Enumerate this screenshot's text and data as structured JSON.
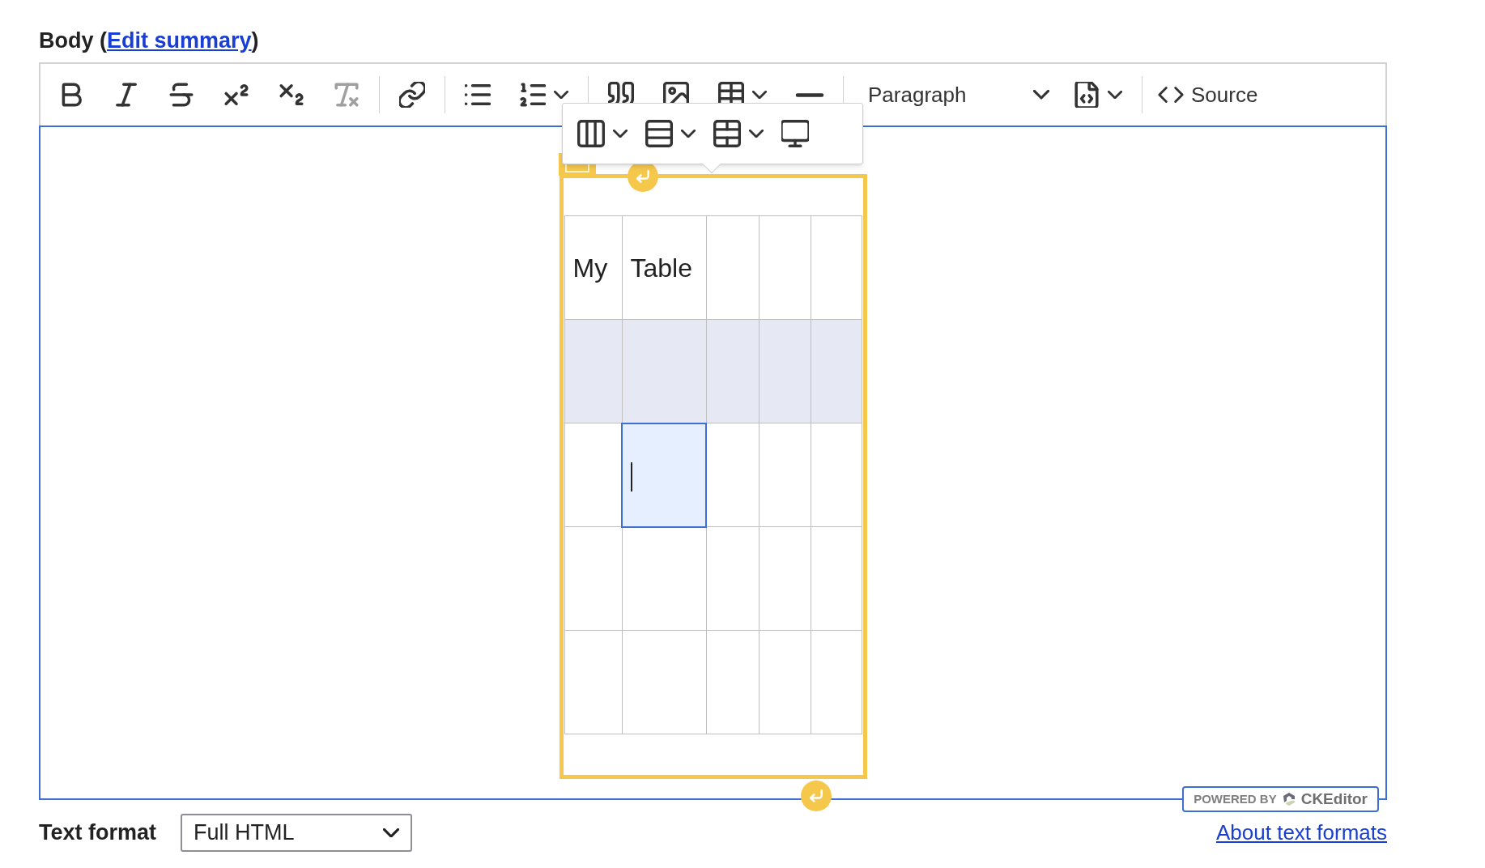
{
  "field_label": {
    "text": "Body (",
    "link": "Edit summary",
    "after": ")"
  },
  "toolbar": [
    {
      "kind": "bold",
      "disabled": false
    },
    {
      "kind": "italic",
      "disabled": false
    },
    {
      "kind": "strikethrough",
      "disabled": false
    },
    {
      "kind": "superscript",
      "disabled": false
    },
    {
      "kind": "subscript",
      "disabled": false
    },
    {
      "kind": "removeformat",
      "disabled": true
    },
    {
      "kind": "separator"
    },
    {
      "kind": "link",
      "disabled": false
    },
    {
      "kind": "separator"
    },
    {
      "kind": "bulletlist",
      "disabled": false
    },
    {
      "kind": "numberlist",
      "disabled": false,
      "dropdown": true
    },
    {
      "kind": "separator"
    },
    {
      "kind": "blockquote",
      "disabled": false
    },
    {
      "kind": "image",
      "disabled": false
    },
    {
      "kind": "table",
      "disabled": false,
      "dropdown": true
    },
    {
      "kind": "hline",
      "disabled": false
    },
    {
      "kind": "separator"
    },
    {
      "kind": "heading",
      "label": "Paragraph"
    },
    {
      "kind": "codeblock",
      "disabled": false,
      "dropdown": true
    },
    {
      "kind": "separator"
    },
    {
      "kind": "source",
      "label": "Source"
    }
  ],
  "table_toolbar": [
    {
      "kind": "column",
      "dropdown": true
    },
    {
      "kind": "row",
      "dropdown": true
    },
    {
      "kind": "merge",
      "dropdown": true
    },
    {
      "kind": "properties",
      "dropdown": false
    }
  ],
  "table": {
    "rows": [
      {
        "highlighted": false,
        "cells": [
          {
            "text": "My",
            "selected": false
          },
          {
            "text": "Table",
            "selected": false
          },
          {
            "selected": false
          },
          {
            "selected": false
          },
          {
            "selected": false
          }
        ]
      },
      {
        "highlighted": true,
        "cells": [
          {
            "selected": false
          },
          {
            "selected": false
          },
          {
            "selected": false
          },
          {
            "selected": false
          },
          {
            "selected": false
          }
        ]
      },
      {
        "highlighted": false,
        "cells": [
          {
            "selected": false
          },
          {
            "selected": true
          },
          {
            "selected": false
          },
          {
            "selected": false
          },
          {
            "selected": false
          }
        ]
      },
      {
        "highlighted": false,
        "cells": [
          {
            "selected": false
          },
          {
            "selected": false
          },
          {
            "selected": false
          },
          {
            "selected": false
          },
          {
            "selected": false
          }
        ]
      },
      {
        "highlighted": false,
        "cells": [
          {
            "selected": false
          },
          {
            "selected": false
          },
          {
            "selected": false
          },
          {
            "selected": false
          },
          {
            "selected": false
          }
        ]
      }
    ]
  },
  "powered_by": {
    "text": "POWERED BY",
    "brand": "CKEditor"
  },
  "text_format": {
    "label": "Text format",
    "value": "Full HTML"
  },
  "about_link": "About text formats"
}
